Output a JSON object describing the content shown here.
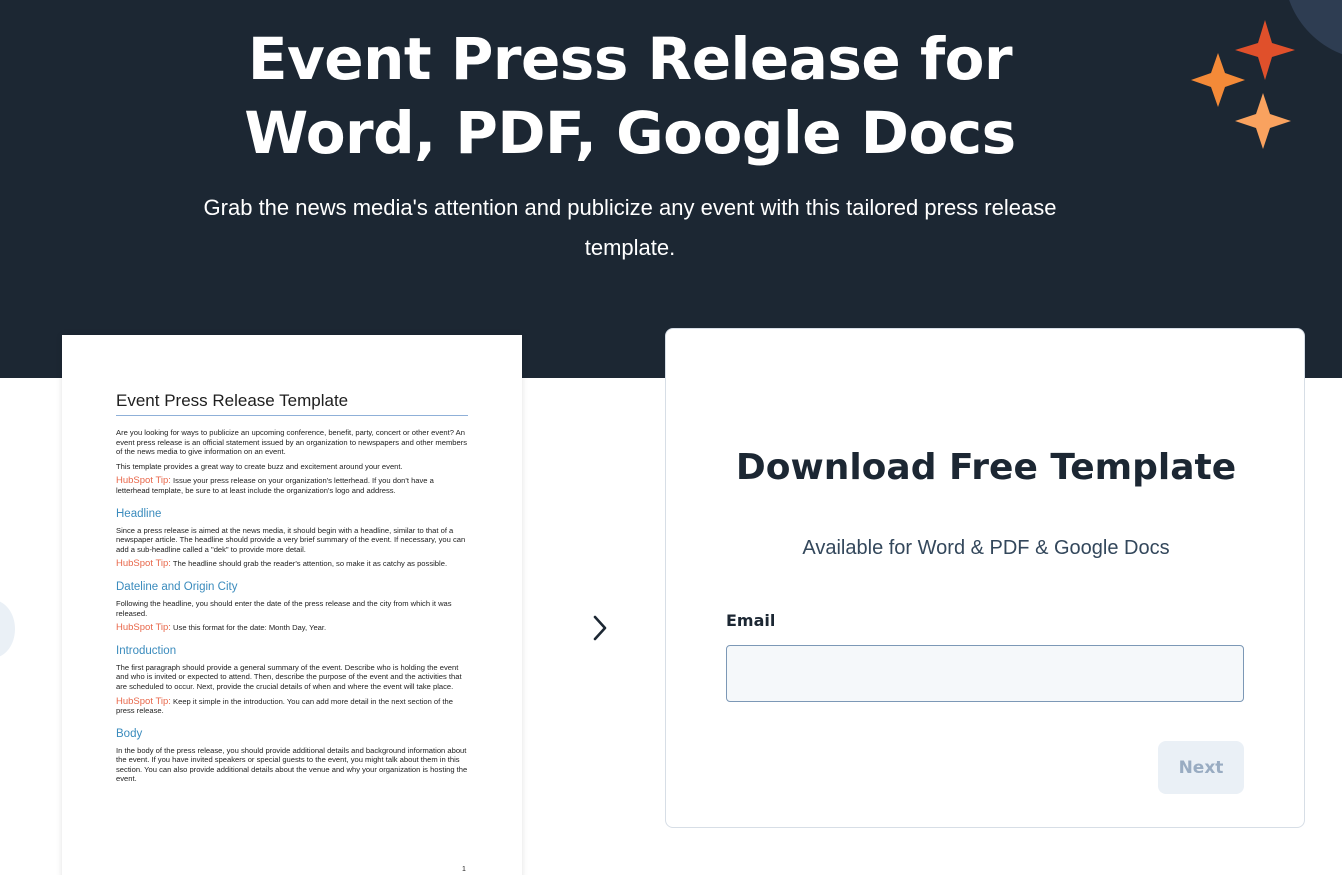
{
  "hero": {
    "title": "Event Press Release for Word, PDF, Google Docs",
    "subtitle": "Grab the news media's attention and publicize any event with this tailored press release template."
  },
  "preview": {
    "doc_title": "Event Press Release Template",
    "intro_1": "Are you looking for ways to publicize an upcoming conference, benefit, party, concert or other event? An event press release is an official statement issued by an organization to newspapers and other members of the news media to give information on an event.",
    "intro_2": "This template provides a great way to create buzz and excitement around your event.",
    "tip_label": "HubSpot Tip:",
    "intro_tip": "Issue your press release on your organization's letterhead. If you don't have a letterhead template, be sure to at least include the organization's logo and address.",
    "sections": [
      {
        "heading": "Headline",
        "body": "Since a press release is aimed at the news media, it should begin with a headline, similar to that of a newspaper article. The headline should provide a very brief summary of the event. If necessary, you can add a sub-headline called a \"dek\" to provide more detail.",
        "tip": "The headline should grab the reader's attention, so make it as catchy as possible."
      },
      {
        "heading": "Dateline and Origin City",
        "body": "Following the headline, you should enter the date of the press release and the city from which it was released.",
        "tip": "Use this format for the date: Month Day, Year."
      },
      {
        "heading": "Introduction",
        "body": "The first paragraph should provide a general summary of the event. Describe who is holding the event and who is invited or expected to attend. Then, describe the purpose of the event and the activities that are scheduled to occur. Next, provide the crucial details of when and where the event will take place.",
        "tip": "Keep it simple in the introduction. You can add more detail in the next section of the press release."
      },
      {
        "heading": "Body",
        "body": "In the body of the press release, you should provide additional details and background information about the event. If you have invited speakers or special guests to the event, you might talk about them in this section. You can also provide additional details about the venue and why your organization is hosting the event."
      }
    ],
    "page_number": "1"
  },
  "form": {
    "title": "Download Free Template",
    "subtitle": "Available for Word & PDF & Google Docs",
    "email_label": "Email",
    "email_value": "",
    "next_label": "Next"
  },
  "colors": {
    "hero_bg": "#1c2733",
    "sparkle_red": "#e0502b",
    "sparkle_orange": "#f48a38",
    "sparkle_peach": "#f9a25f",
    "tip_color": "#e8674a",
    "heading_blue": "#3a8bbd"
  },
  "icons": {
    "sparkles": "sparkles-icon",
    "carousel_next": "chevron-right-icon",
    "carousel_prev": "carousel-prev-button"
  }
}
